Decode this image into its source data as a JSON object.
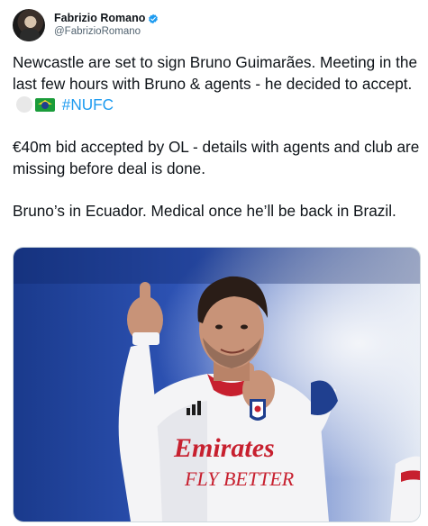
{
  "author": {
    "display_name": "Fabrizio Romano",
    "handle": "@FabrizioRomano",
    "verified": true,
    "verified_color": "#1d9bf0"
  },
  "tweet": {
    "para1_text": "Newcastle are set to sign Bruno Guimarães. Meeting in the last few hours with Bruno & agents - he decided to accept. ",
    "para1_emoji_1": "white-circle-emoji",
    "para1_emoji_2": "brazil-flag-emoji",
    "hashtag": "#NUFC",
    "para2": "€40m bid accepted by OL - details with agents and club are missing before deal is done.",
    "para3": "Bruno’s in Ecuador. Medical once he’ll be back in Brazil."
  },
  "media": {
    "jersey_sponsor_line1": "Emirates",
    "jersey_sponsor_line2": "FLY BETTER"
  },
  "colors": {
    "text": "#0f1419",
    "secondary": "#536471",
    "link": "#1d9bf0"
  }
}
